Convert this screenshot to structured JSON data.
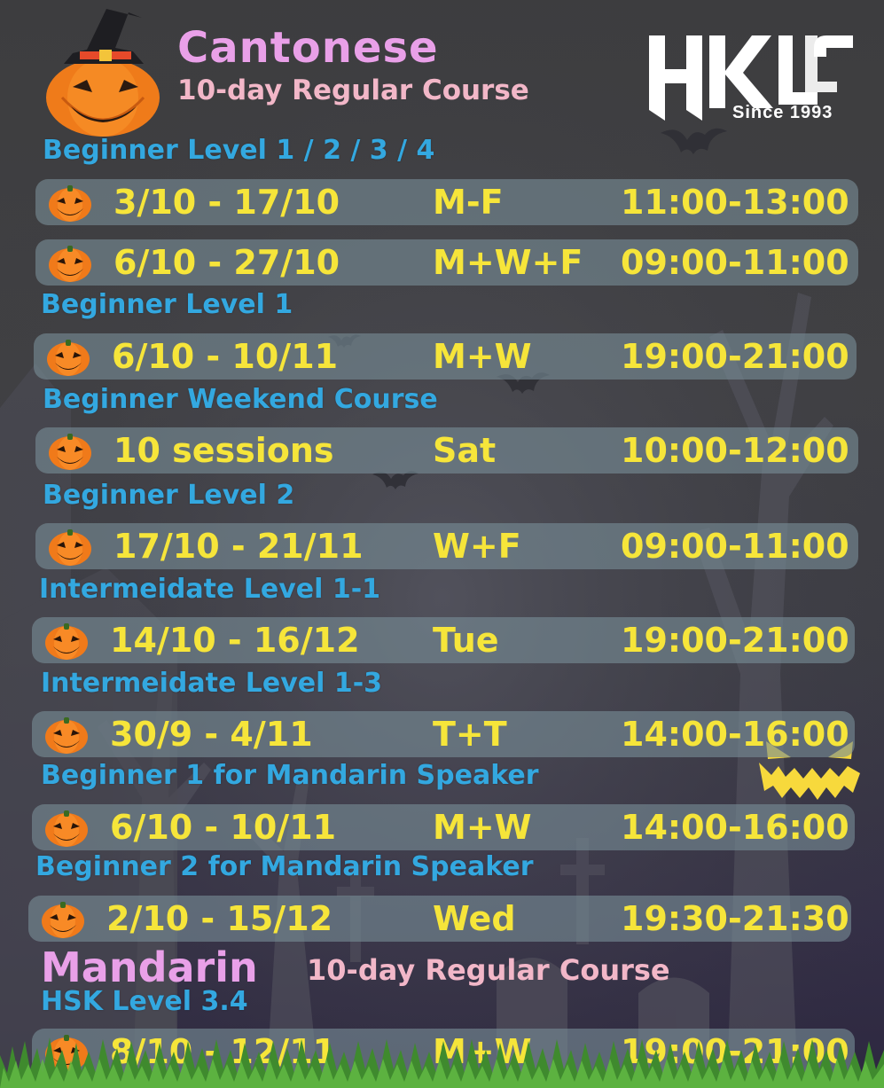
{
  "header": {
    "title": "Cantonese",
    "subtitle": "10-day Regular Course",
    "logo_text": "HKLLC",
    "logo_tagline": "Since 1993"
  },
  "sections": [
    {
      "heading": "Beginner Level 1 / 2 / 3 / 4",
      "rows": [
        {
          "dates": "3/10 - 17/10",
          "days": "M-F",
          "time": "11:00-13:00"
        },
        {
          "dates": "6/10 - 27/10",
          "days": "M+W+F",
          "time": "09:00-11:00"
        }
      ]
    },
    {
      "heading": "Beginner Level 1",
      "rows": [
        {
          "dates": "6/10 - 10/11",
          "days": "M+W",
          "time": "19:00-21:00"
        }
      ]
    },
    {
      "heading": "Beginner Weekend Course",
      "rows": [
        {
          "dates": "10 sessions",
          "days": "Sat",
          "time": "10:00-12:00"
        }
      ]
    },
    {
      "heading": "Beginner Level 2",
      "rows": [
        {
          "dates": "17/10 - 21/11",
          "days": "W+F",
          "time": "09:00-11:00"
        }
      ]
    },
    {
      "heading": "Intermeidate Level 1-1",
      "rows": [
        {
          "dates": "14/10 - 16/12",
          "days": "Tue",
          "time": "19:00-21:00"
        }
      ]
    },
    {
      "heading": "Intermeidate Level 1-3",
      "rows": [
        {
          "dates": "30/9 - 4/11",
          "days": "T+T",
          "time": "14:00-16:00"
        }
      ]
    },
    {
      "heading": "Beginner 1 for Mandarin Speaker",
      "rows": [
        {
          "dates": "6/10 - 10/11",
          "days": "M+W",
          "time": "14:00-16:00"
        }
      ]
    },
    {
      "heading": "Beginner 2 for Mandarin Speaker",
      "rows": [
        {
          "dates": "2/10 - 15/12",
          "days": "Wed",
          "time": "19:30-21:30"
        }
      ]
    }
  ],
  "mandarin": {
    "title": "Mandarin",
    "subtitle": "10-day Regular Course",
    "heading": "HSK Level 3.4",
    "rows": [
      {
        "dates": "8/10 - 12/11",
        "days": "M+W",
        "time": "19:00-21:00"
      }
    ]
  },
  "colors": {
    "title": "#e9a0e8",
    "subtitle": "#f2b7c8",
    "section_heading": "#33a8e0",
    "row_text": "#f6e53a",
    "pumpkin": "#f07a1a"
  },
  "icons": [
    "pumpkin-icon",
    "witch-hat-pumpkin",
    "bat-icon",
    "jack-o-lantern-teeth",
    "hkllc-logo"
  ]
}
